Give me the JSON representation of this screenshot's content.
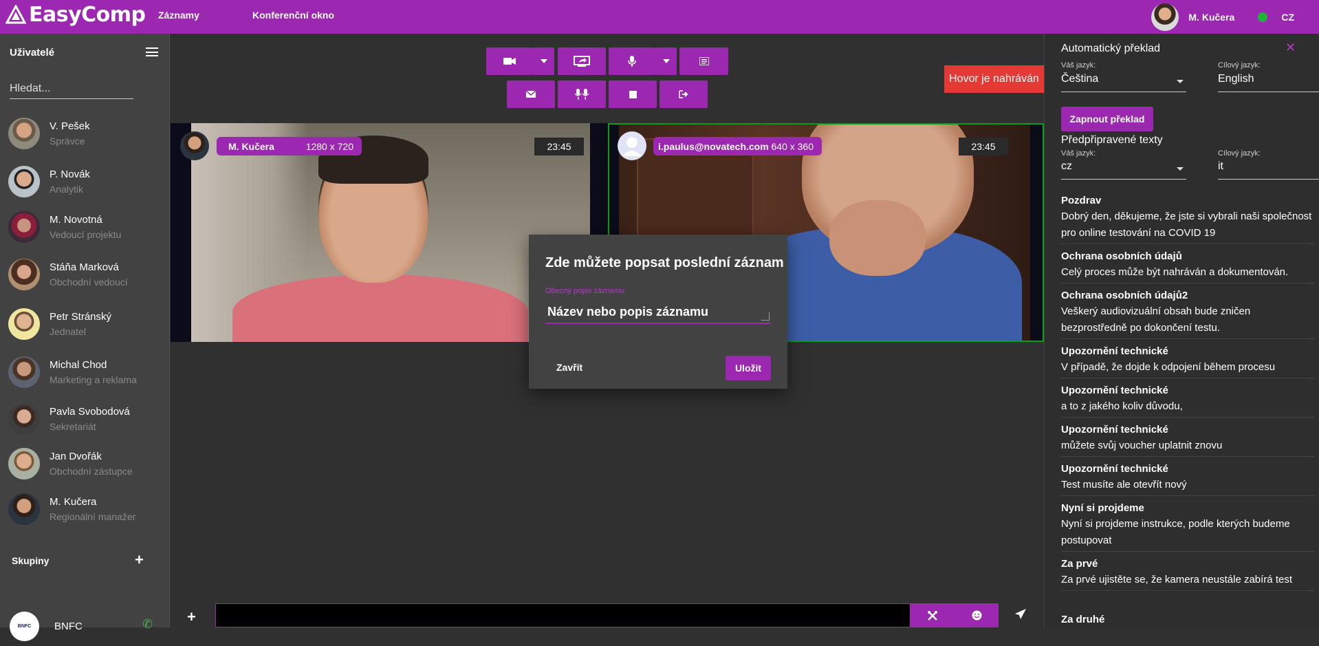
{
  "app": {
    "name": "EasyComp"
  },
  "nav": {
    "records": "Záznamy",
    "conference": "Konferenční okno"
  },
  "current_user": {
    "name": "M. Kučera",
    "language": "CZ",
    "status_color": "#1db33b"
  },
  "colors": {
    "accent": "#9c27b0",
    "recording": "#e53935",
    "active_video_border": "#0a9e18"
  },
  "sidebar": {
    "title": "Uživatelé",
    "search_placeholder": "Hledat...",
    "contacts": [
      {
        "name": "V. Pešek",
        "role": "Správce"
      },
      {
        "name": "P. Novák",
        "role": "Analytik"
      },
      {
        "name": "M. Novotná",
        "role": "Vedoucí projektu"
      },
      {
        "name": "Stáňa Marková",
        "role": "Obchodní vedoucí"
      },
      {
        "name": "Petr Stránský",
        "role": "Jednatel"
      },
      {
        "name": "Michal Chod",
        "role": "Marketing a reklama"
      },
      {
        "name": "Pavla Svobodová",
        "role": "Sekretariát"
      },
      {
        "name": "Jan Dvořák",
        "role": "Obchodní zástupce"
      },
      {
        "name": "M. Kučera",
        "role": "Regionální manažer"
      }
    ],
    "groups_title": "Skupiny",
    "groups": [
      {
        "name": "BNFC",
        "logo_text": "BNFC"
      }
    ]
  },
  "controls": {
    "row1": [
      "camera-icon",
      "chevron-down-icon",
      "screen-share-icon",
      "microphone-icon",
      "chevron-down-icon",
      "list-icon"
    ],
    "row2": [
      "mail-icon",
      "mic-group-icon",
      "stop-icon",
      "exit-icon"
    ]
  },
  "recording_label": "Hovor je nahráván",
  "videos": [
    {
      "name": "M. Kučera",
      "resolution": "1280 x 720",
      "time": "23:45"
    },
    {
      "name": "i.paulus@novatech.com",
      "resolution": "640 x 360",
      "time": "23:45"
    }
  ],
  "dialog": {
    "title": "Zde můžete popsat poslední záznam",
    "field_label": "Obecný popis záznamu",
    "field_value": "Název nebo popis záznamu",
    "close": "Zavřít",
    "save": "Uložit"
  },
  "translation": {
    "title": "Automatický překlad",
    "your_lang_label": "Váš jazyk:",
    "target_lang_label": "Cílový jazyk:",
    "your_lang": "Čeština",
    "target_lang": "English",
    "enable_button": "Zapnout překlad",
    "prepared_title": "Předpřipravené texty",
    "prep_your_lang": "cz",
    "prep_target_lang": "it",
    "phrases": [
      {
        "heading": "Pozdrav",
        "text": "Dobrý den, děkujeme, že jste si vybrali naši společnost pro online testování na COVID 19"
      },
      {
        "heading": "Ochrana osobních údajů",
        "text": "Celý proces může být nahráván a dokumentován."
      },
      {
        "heading": "Ochrana osobních údajů2",
        "text": "Veškerý audiovizuální obsah bude zničen bezprostředně po dokončení testu."
      },
      {
        "heading": "Upozornění technické",
        "text": "V případě, že dojde k odpojení během procesu"
      },
      {
        "heading": "Upozornění technické",
        "text": "a to z jakého koliv důvodu,"
      },
      {
        "heading": "Upozornění technické",
        "text": "můžete svůj voucher uplatnit znovu"
      },
      {
        "heading": "Upozornění technické",
        "text": "Test musíte ale otevřít nový"
      },
      {
        "heading": "Nyní si projdeme",
        "text": "Nyní si projdeme instrukce, podle kterých budeme postupovat"
      },
      {
        "heading": "Za prvé",
        "text": "Za prvé ujistěte se, že kamera neustále zabírá test"
      },
      {
        "heading": "Za druhé",
        "text": ""
      }
    ]
  }
}
